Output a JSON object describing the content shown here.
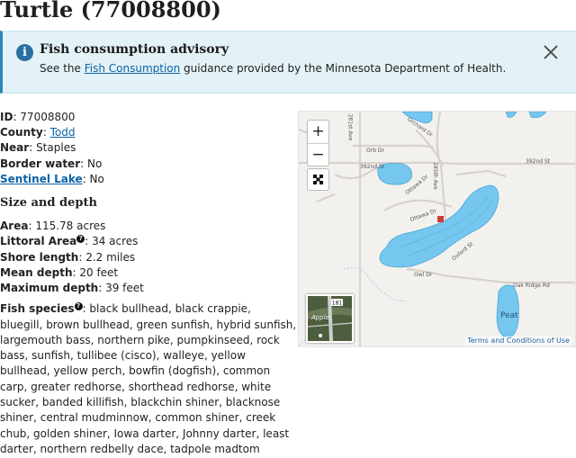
{
  "title": "Turtle (77008800)",
  "advisory": {
    "title": "Fish consumption advisory",
    "text_before": "See the ",
    "link": "Fish Consumption",
    "text_after": " guidance provided by the Minnesota Department of Health."
  },
  "info": {
    "id_label": "ID",
    "id_value": "77008800",
    "county_label": "County",
    "county_value": "Todd",
    "near_label": "Near",
    "near_value": "Staples",
    "border_label": "Border water",
    "border_value": "No",
    "sentinel_label": "Sentinel Lake",
    "sentinel_value": "No"
  },
  "size": {
    "heading": "Size and depth",
    "area_label": "Area",
    "area_value": "115.78 acres",
    "littoral_label": "Littoral Area",
    "littoral_value": "34 acres",
    "shore_label": "Shore length",
    "shore_value": "2.2 miles",
    "mean_label": "Mean depth",
    "mean_value": "20 feet",
    "max_label": "Maximum depth",
    "max_value": "39 feet"
  },
  "species": {
    "label": "Fish species",
    "text": "black bullhead, black crappie, bluegill, brown bullhead, green sunfish, hybrid sunfish, largemouth bass, northern pike, pumpkinseed, rock bass, sunfish, tullibee (cisco), walleye, yellow bullhead, yellow perch, bowfin (dogfish), common carp, greater redhorse, shorthead redhorse, white sucker, banded killifish, blackchin shiner, blacknose shiner, central mudminnow, common shiner, creek chub, golden shiner, Iowa darter, Johnny darter, least darter, northern redbelly dace, tadpole madtom"
  },
  "map": {
    "zoom_in": "+",
    "zoom_out": "−",
    "terms": "Terms and Conditions of Use",
    "peat": "Peat",
    "thumb_label": "Apple",
    "road_badge": "181",
    "labels": {
      "orb": "Orb Dr",
      "orchard": "Orchard Dr",
      "st392_left": "392nd St",
      "st392_right": "392nd St",
      "ottawa1": "Ottawa Dr",
      "ottawa2": "Ottawa Dr",
      "ave281": "281st Ave",
      "ave285": "285th Ave",
      "oxford": "Oxford St",
      "owl": "Owl Dr",
      "oak_ridge": "Oak Ridge Rd"
    },
    "water_color": "#75c7ef",
    "water_edge": "#4aa6d6"
  }
}
